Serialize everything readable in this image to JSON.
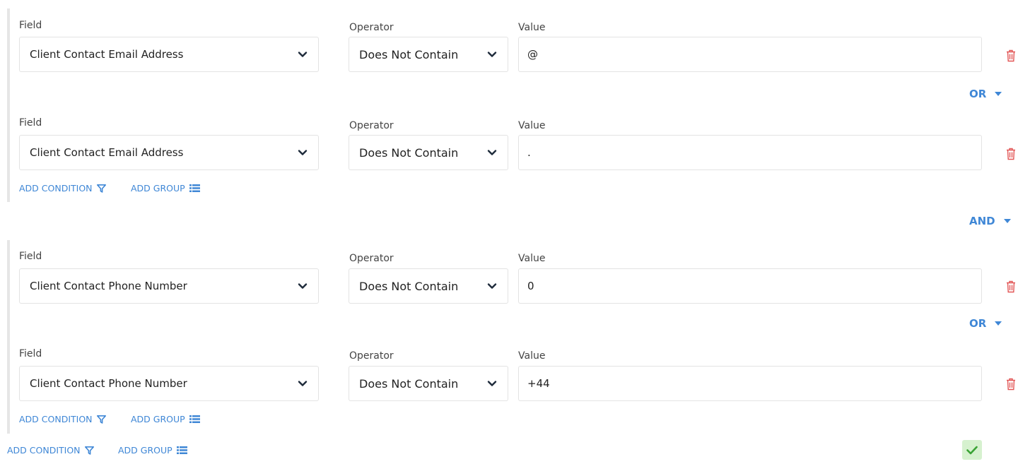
{
  "labels": {
    "field": "Field",
    "operator": "Operator",
    "value": "Value"
  },
  "groups": [
    {
      "conditions": [
        {
          "field": "Client Contact Email Address",
          "operator": "Does Not Contain",
          "value": "@"
        },
        {
          "field": "Client Contact Email Address",
          "operator": "Does Not Contain",
          "value": "."
        }
      ],
      "inner_conjunction": "OR"
    },
    {
      "conditions": [
        {
          "field": "Client Contact Phone Number",
          "operator": "Does Not Contain",
          "value": "0"
        },
        {
          "field": "Client Contact Phone Number",
          "operator": "Does Not Contain",
          "value": "+44"
        }
      ],
      "inner_conjunction": "OR"
    }
  ],
  "outer_conjunction": "AND",
  "actions": {
    "add_condition": "ADD CONDITION",
    "add_group": "ADD GROUP"
  },
  "icons": [
    "chevron-down-icon",
    "trash-icon",
    "filter-icon",
    "list-icon",
    "caret-down-icon",
    "check-icon"
  ],
  "colors": {
    "accent": "#3f87d6",
    "delete": "#e25555",
    "confirm_bg": "#d6f1cf",
    "confirm_icon": "#3aa335"
  }
}
